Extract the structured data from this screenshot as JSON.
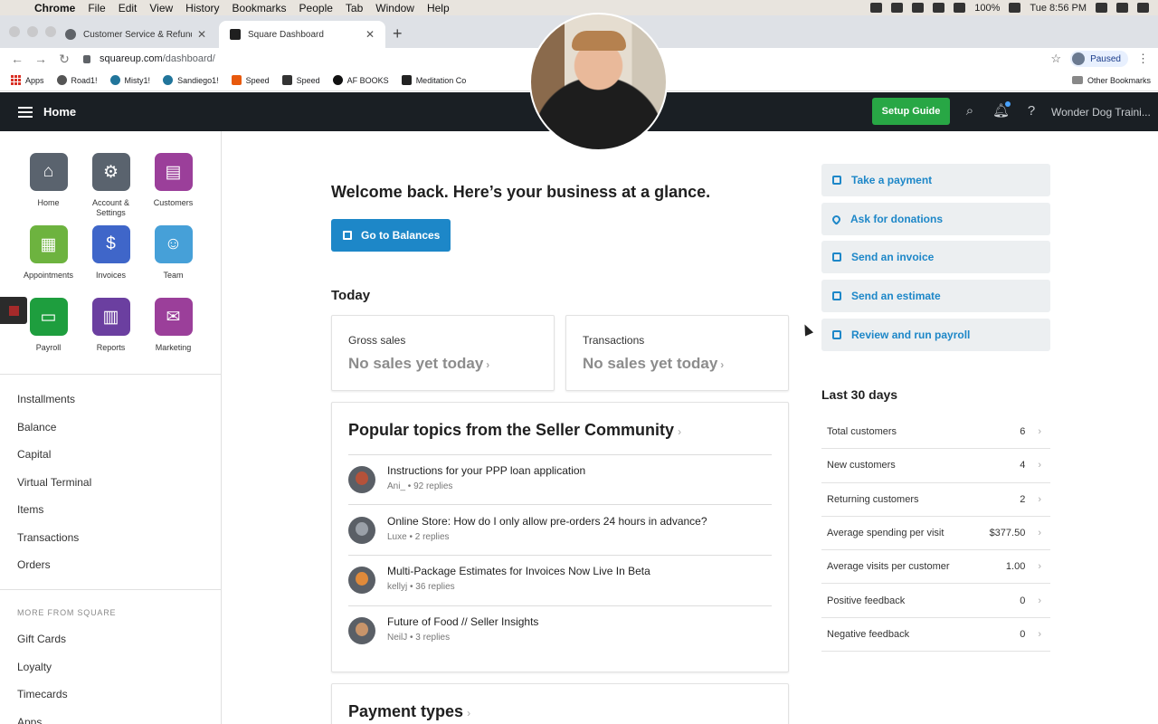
{
  "menubar": {
    "app": "Chrome",
    "items": [
      "File",
      "Edit",
      "View",
      "History",
      "Bookmarks",
      "People",
      "Tab",
      "Window",
      "Help"
    ],
    "battery": "100%",
    "clock": "Tue 8:56 PM"
  },
  "browser": {
    "tabs": [
      {
        "title": "Customer Service & Refunds –"
      },
      {
        "title": "Square Dashboard"
      }
    ],
    "url_host": "squareup.com",
    "url_path": "/dashboard/",
    "profile_status": "Paused",
    "bookmarks": [
      "Apps",
      "Road1!",
      "Misty1!",
      "Sandiego1!",
      "Speed",
      "Speed",
      "AF BOOKS",
      "Meditation Co"
    ],
    "other_bookmarks": "Other Bookmarks"
  },
  "header": {
    "title": "Home",
    "setup_guide": "Setup Guide",
    "business_name": "Wonder Dog Traini..."
  },
  "sidebar": {
    "apps": [
      {
        "label": "Home",
        "color": "#5a636e",
        "icon": "home-icon"
      },
      {
        "label": "Account & Settings",
        "color": "#5a636e",
        "icon": "gear-icon"
      },
      {
        "label": "Customers",
        "color": "#9b3f9a",
        "icon": "id-card-icon"
      },
      {
        "label": "Appointments",
        "color": "#6db33f",
        "icon": "calendar-icon"
      },
      {
        "label": "Invoices",
        "color": "#3f66c9",
        "icon": "invoice-icon"
      },
      {
        "label": "Team",
        "color": "#46a0d8",
        "icon": "team-icon"
      },
      {
        "label": "Payroll",
        "color": "#1e9e3e",
        "icon": "payroll-icon"
      },
      {
        "label": "Reports",
        "color": "#6b3fa0",
        "icon": "bar-chart-icon"
      },
      {
        "label": "Marketing",
        "color": "#9b3f9a",
        "icon": "envelope-icon"
      }
    ],
    "links": [
      "Installments",
      "Balance",
      "Capital",
      "Virtual Terminal",
      "Items",
      "Transactions",
      "Orders"
    ],
    "more_caption": "MORE FROM SQUARE",
    "more_links": [
      "Gift Cards",
      "Loyalty",
      "Timecards",
      "Apps"
    ]
  },
  "main": {
    "welcome": "Welcome back. Here’s your business at a glance.",
    "balances_button": "Go to Balances",
    "today_heading": "Today",
    "gross_sales": {
      "label": "Gross sales",
      "value": "No sales yet today"
    },
    "transactions": {
      "label": "Transactions",
      "value": "No sales yet today"
    },
    "topics_heading": "Popular topics from the Seller Community",
    "topics": [
      {
        "title": "Instructions for your PPP loan application",
        "meta": "Ani_ • 92 replies",
        "avatar_color": "#b5523a"
      },
      {
        "title": "Online Store: How do I only allow pre-orders 24 hours in advance?",
        "meta": "Luxe • 2 replies",
        "avatar_color": "#9aa0a8"
      },
      {
        "title": "Multi-Package Estimates for Invoices Now Live In Beta",
        "meta": "kellyj • 36 replies",
        "avatar_color": "#e08a3a"
      },
      {
        "title": "Future of Food // Seller Insights",
        "meta": "NeilJ • 3 replies",
        "avatar_color": "#c8946a"
      }
    ],
    "payment_types_heading": "Payment types"
  },
  "actions": [
    {
      "label": "Take a payment",
      "icon": "dollar-icon"
    },
    {
      "label": "Ask for donations",
      "icon": "heart-icon"
    },
    {
      "label": "Send an invoice",
      "icon": "invoice-icon"
    },
    {
      "label": "Send an estimate",
      "icon": "estimate-icon"
    },
    {
      "label": "Review and run payroll",
      "icon": "payroll-icon"
    }
  ],
  "last30": {
    "heading": "Last 30 days",
    "metrics": [
      {
        "name": "Total customers",
        "value": "6"
      },
      {
        "name": "New customers",
        "value": "4"
      },
      {
        "name": "Returning customers",
        "value": "2"
      },
      {
        "name": "Average spending per visit",
        "value": "$377.50"
      },
      {
        "name": "Average visits per customer",
        "value": "1.00"
      },
      {
        "name": "Positive feedback",
        "value": "0"
      },
      {
        "name": "Negative feedback",
        "value": "0"
      }
    ]
  }
}
